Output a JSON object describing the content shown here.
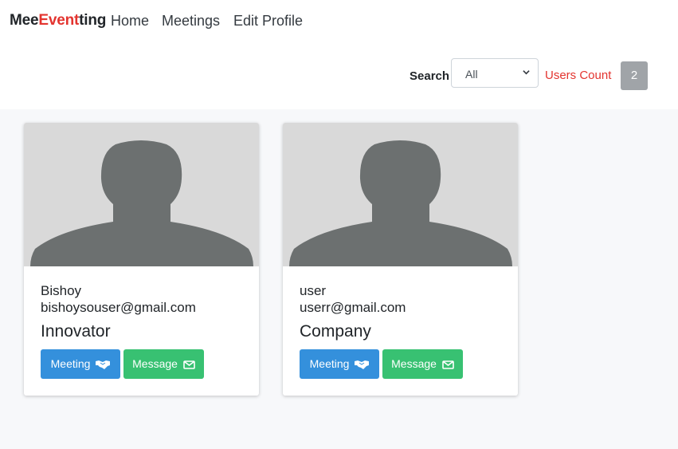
{
  "navbar": {
    "brand_prefix": "Mee",
    "brand_highlight": "Event",
    "brand_suffix": "ting",
    "links": [
      "Home",
      "Meetings",
      "Edit Profile"
    ]
  },
  "toolbar": {
    "search_label": "Search",
    "filter_value": "All",
    "users_count_label": "Users Count",
    "users_count": "2"
  },
  "colors": {
    "brand_red": "#e3342f",
    "meeting_button": "#3490dc",
    "message_button": "#38c172",
    "badge": "#a0a4a8"
  },
  "users": [
    {
      "name": "Bishoy",
      "email": "bishoysouser@gmail.com",
      "role": "Innovator",
      "meeting_label": "Meeting",
      "message_label": "Message",
      "avatar_icon": "user-placeholder-icon"
    },
    {
      "name": "user",
      "email": "userr@gmail.com",
      "role": "Company",
      "meeting_label": "Meeting",
      "message_label": "Message",
      "avatar_icon": "user-placeholder-icon"
    }
  ]
}
